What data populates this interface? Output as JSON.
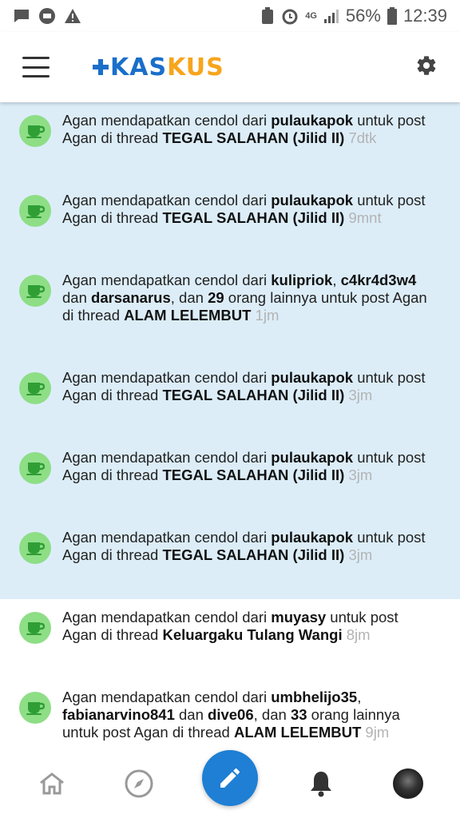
{
  "status_bar": {
    "battery": "56%",
    "time": "12:39",
    "network": "4G"
  },
  "app": {
    "logo_part1": "KAS",
    "logo_part2": "KUS"
  },
  "notifications": [
    {
      "state": "unread",
      "rows": [
        "Agan mendapatkan cendol dari {pulaukapok} untuk post",
        "Agan di thread {TEGAL SALAHAN (Jilid II)} [7dtk]"
      ]
    },
    {
      "state": "unread",
      "rows": [
        "Agan mendapatkan cendol dari {pulaukapok} untuk post",
        "Agan di thread {TEGAL SALAHAN (Jilid II)} [9mnt]"
      ]
    },
    {
      "state": "unread",
      "rows": [
        "Agan mendapatkan cendol dari {kulipriok}, {c4kr4d3w4}",
        "dan {darsanarus}, dan {29} orang lainnya untuk post Agan",
        "di thread {ALAM LELEMBUT} [1jm]"
      ]
    },
    {
      "state": "unread",
      "rows": [
        "Agan mendapatkan cendol dari {pulaukapok} untuk post",
        "Agan di thread {TEGAL SALAHAN (Jilid II)} [3jm]"
      ]
    },
    {
      "state": "unread",
      "rows": [
        "Agan mendapatkan cendol dari {pulaukapok} untuk post",
        "Agan di thread {TEGAL SALAHAN (Jilid II)} [3jm]"
      ]
    },
    {
      "state": "unread",
      "rows": [
        "Agan mendapatkan cendol dari {pulaukapok} untuk post",
        "Agan di thread {TEGAL SALAHAN (Jilid II)} [3jm]"
      ]
    },
    {
      "state": "read",
      "rows": [
        "Agan mendapatkan cendol dari {muyasy} untuk post",
        "Agan di thread {Keluargaku Tulang Wangi} [8jm]"
      ]
    },
    {
      "state": "read",
      "rows": [
        "Agan mendapatkan cendol dari {umbhelijo35},",
        "{fabianarvino841} dan {dive06}, dan {33} orang lainnya",
        "untuk post Agan di thread {ALAM LELEMBUT} [9jm]"
      ]
    }
  ],
  "bottom_nav": [
    {
      "name": "home-icon"
    },
    {
      "name": "compass-icon"
    },
    {
      "name": "pencil-icon"
    },
    {
      "name": "bell-icon"
    },
    {
      "name": "avatar"
    }
  ],
  "colors": {
    "unread_bg": "#dcedf8",
    "accent": "#1e7fd4",
    "cendol_green": "#8ede86",
    "logo_blue": "#1a6fc9",
    "logo_orange": "#f7a51c",
    "time_gray": "#b3b3b3"
  }
}
